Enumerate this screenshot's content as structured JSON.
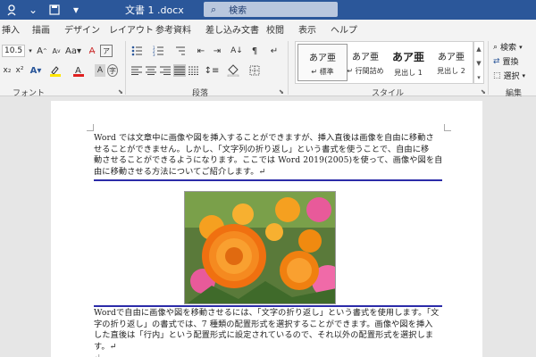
{
  "titlebar": {
    "doc_title": "文書 1 .docx",
    "search_label": "検索",
    "colors": {
      "bar": "#2b579a"
    }
  },
  "tabs": [
    "挿入",
    "描画",
    "デザイン",
    "レイアウト",
    "参考資料",
    "差し込み文書",
    "校閲",
    "表示",
    "ヘルプ"
  ],
  "ribbon": {
    "font_size": "10.5",
    "groups": [
      "フォント",
      "段落",
      "スタイル",
      "編集"
    ],
    "styles": [
      {
        "sample": "あア亜",
        "name": "↵ 標準"
      },
      {
        "sample": "あア亜",
        "name": "↵ 行間詰め"
      },
      {
        "sample": "あア亜",
        "name": "見出し 1"
      },
      {
        "sample": "あア亜",
        "name": "見出し 2"
      }
    ],
    "editing": {
      "find": "検索",
      "replace": "置換",
      "select": "選択"
    }
  },
  "document": {
    "para1": [
      "Word では文章中に画像や図を挿入することができますが、挿入直後は画像を自由に移動さ",
      "せることができません。しかし、「文字列の折り返し」という書式を使うことで、自由に移",
      "動させることができるようになります。ここでは Word 2019(2005)を使って、画像や図を自",
      "由に移動させる方法についてご紹介します。↵"
    ],
    "para2": [
      "Wordで自由に画像や図を移動させるには、「文字の折り返し」という書式を使用します。「文",
      "字の折り返し」の書式では、7 種類の配置形式を選択することができます。画像や図を挿入",
      "した直後は「行内」という配置形式に設定されているので、それ以外の配置形式を選択しま",
      "す。↵"
    ],
    "trailing_mark": "↵",
    "image_alt": "orange marigold flowers"
  }
}
